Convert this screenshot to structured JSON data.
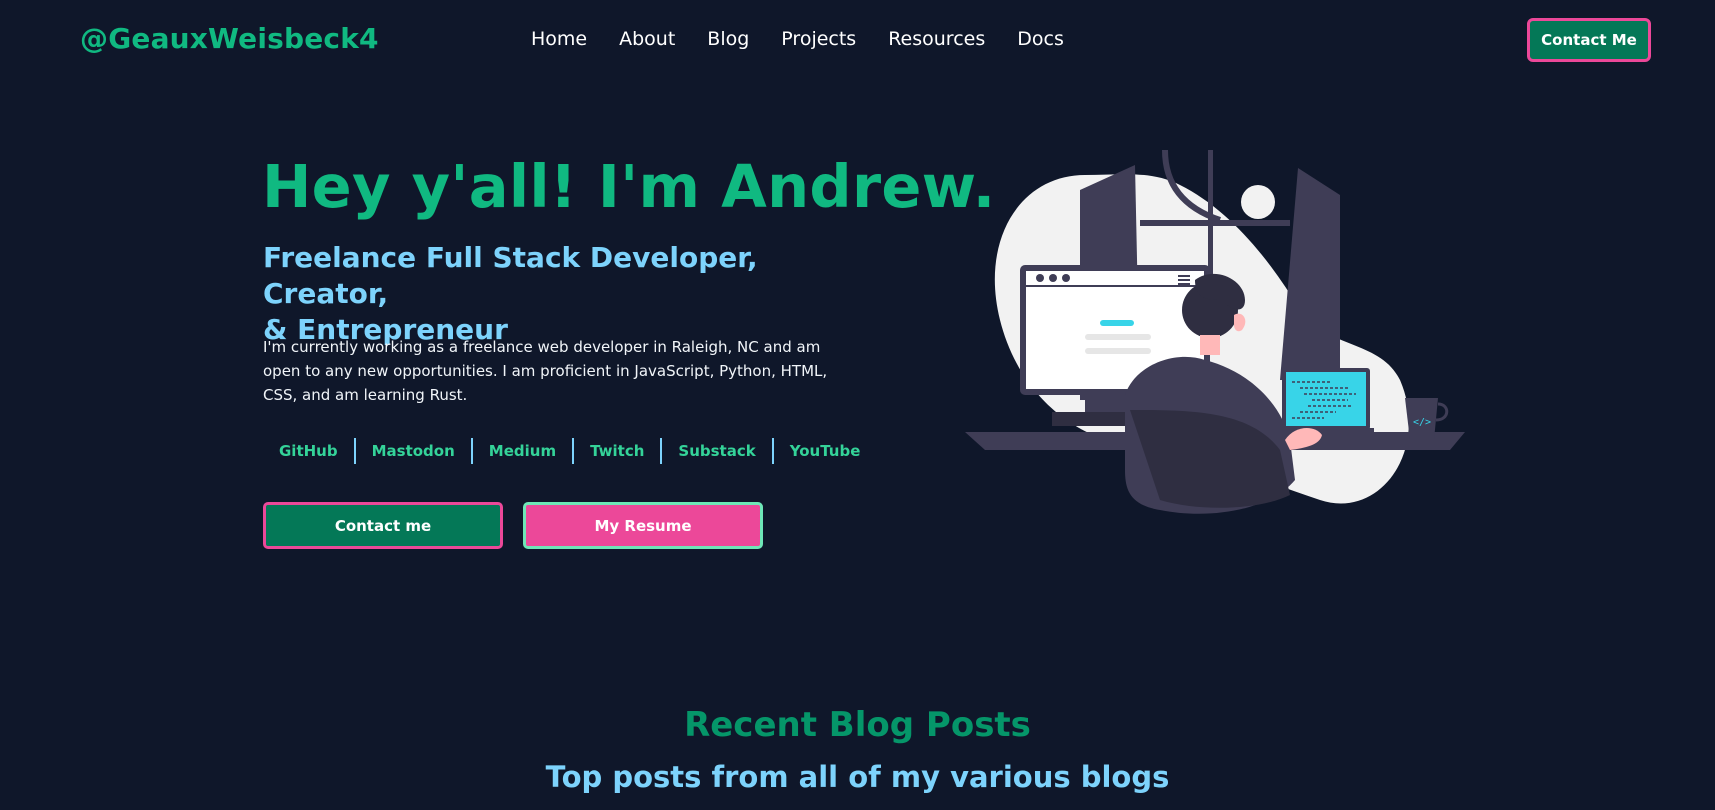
{
  "header": {
    "brand": "@GeauxWeisbeck4",
    "nav": [
      "Home",
      "About",
      "Blog",
      "Projects",
      "Resources",
      "Docs"
    ],
    "contact_button": "Contact Me"
  },
  "hero": {
    "title": "Hey y'all! I'm Andrew.",
    "subtitle_line1": "Freelance Full Stack Developer, Creator,",
    "subtitle_line2": "& Entrepreneur",
    "description": "I'm currently working as a freelance web developer in Raleigh, NC and am open to any new opportunities. I am proficient in JavaScript, Python, HTML, CSS, and am learning Rust.",
    "social_links": [
      "GitHub",
      "Mastodon",
      "Medium",
      "Twitch",
      "Substack",
      "YouTube"
    ],
    "contact_button": "Contact me",
    "resume_button": "My Resume"
  },
  "blog_section": {
    "title": "Recent Blog Posts",
    "subtitle": "Top posts from all of my various blogs"
  },
  "colors": {
    "background": "#0f172a",
    "accent_green": "#10b981",
    "accent_blue": "#7dd3fc",
    "accent_pink": "#ec4899"
  }
}
